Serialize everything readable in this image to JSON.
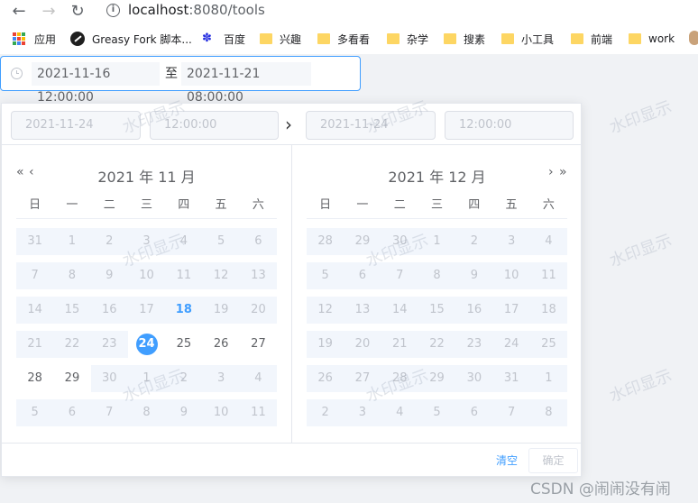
{
  "browser": {
    "back_icon": "←",
    "forward_icon": "→",
    "reload_icon": "↻",
    "url_host": "localhost",
    "url_rest": ":8080/tools",
    "bookmarks": [
      {
        "label": "应用",
        "icon": "apps-grid-icon"
      },
      {
        "label": "Greasy Fork 脚本...",
        "icon": "greasy-fork-icon"
      },
      {
        "label": "百度",
        "icon": "baidu-paw-icon"
      },
      {
        "label": "兴趣",
        "icon": "folder-icon"
      },
      {
        "label": "多看看",
        "icon": "folder-icon"
      },
      {
        "label": "杂学",
        "icon": "folder-icon"
      },
      {
        "label": "搜素",
        "icon": "folder-icon"
      },
      {
        "label": "小工具",
        "icon": "folder-icon"
      },
      {
        "label": "前端",
        "icon": "folder-icon"
      },
      {
        "label": "work",
        "icon": "folder-icon"
      }
    ]
  },
  "range": {
    "start": "2021-11-16 12:00:00",
    "separator": "至",
    "end": "2021-11-21 08:00:00"
  },
  "picker": {
    "start_date_placeholder": "2021-11-24",
    "start_time_placeholder": "12:00:00",
    "end_date_placeholder": "2021-11-24",
    "end_time_placeholder": "12:00:00",
    "arrow": "›",
    "weekdays": [
      "日",
      "一",
      "二",
      "三",
      "四",
      "五",
      "六"
    ],
    "left": {
      "title": "2021 年 11 月",
      "prev_year": "«",
      "prev_month": "‹",
      "weeks": [
        [
          "31",
          "1",
          "2",
          "3",
          "4",
          "5",
          "6"
        ],
        [
          "7",
          "8",
          "9",
          "10",
          "11",
          "12",
          "13"
        ],
        [
          "14",
          "15",
          "16",
          "17",
          "18",
          "19",
          "20"
        ],
        [
          "21",
          "22",
          "23",
          "24",
          "25",
          "26",
          "27"
        ],
        [
          "28",
          "29",
          "30",
          "1",
          "2",
          "3",
          "4"
        ],
        [
          "5",
          "6",
          "7",
          "8",
          "9",
          "10",
          "11"
        ]
      ]
    },
    "right": {
      "title": "2021 年 12 月",
      "next_month": "›",
      "next_year": "»",
      "weeks": [
        [
          "28",
          "29",
          "30",
          "1",
          "2",
          "3",
          "4"
        ],
        [
          "5",
          "6",
          "7",
          "8",
          "9",
          "10",
          "11"
        ],
        [
          "12",
          "13",
          "14",
          "15",
          "16",
          "17",
          "18"
        ],
        [
          "19",
          "20",
          "21",
          "22",
          "23",
          "24",
          "25"
        ],
        [
          "26",
          "27",
          "28",
          "29",
          "30",
          "31",
          "1"
        ],
        [
          "2",
          "3",
          "4",
          "5",
          "6",
          "7",
          "8"
        ]
      ]
    },
    "clear_label": "清空",
    "confirm_label": "确定"
  },
  "watermark_text": "水印显示",
  "csdn_credit": "CSDN @闹闹没有闹",
  "colors": {
    "accent": "#409eff",
    "disabled_text": "#c0c4cc",
    "disabled_bg": "#f2f6fc"
  }
}
